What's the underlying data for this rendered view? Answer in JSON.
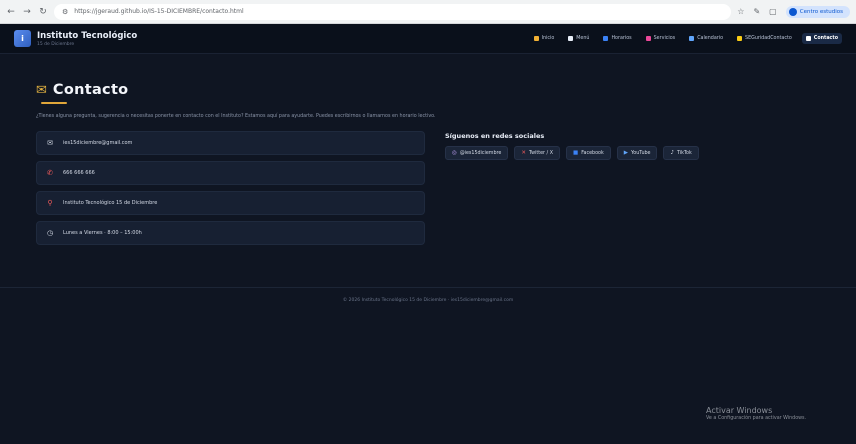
{
  "browser": {
    "url": "https://jgeraud.github.io/IS-15-DICIEMBRE/contacto.html",
    "profile_label": "Centro estudios"
  },
  "header": {
    "logo_letter": "i",
    "brand_title": "Instituto Tecnológico",
    "brand_subtitle": "15 de Diciembre",
    "nav": [
      {
        "label": "Inicio",
        "color": "#f2b134"
      },
      {
        "label": "Menú",
        "color": "#e8eef8"
      },
      {
        "label": "Horarios",
        "color": "#3b82f6"
      },
      {
        "label": "Servicios",
        "color": "#ec4899"
      },
      {
        "label": "Calendario",
        "color": "#60a5fa"
      },
      {
        "label": "SEGuridadContacto",
        "color": "#facc15"
      },
      {
        "label": "Contacto",
        "color": "#ffffff"
      }
    ]
  },
  "page": {
    "title": "Contacto",
    "intro": "¿Tienes alguna pregunta, sugerencia o necesitas ponerte en contacto con el Instituto? Estamos aquí para ayudarte. Puedes escribirnos o llamarnos en horario lectivo."
  },
  "contacts": [
    {
      "icon": "mail-icon",
      "glyph": "✉",
      "color": "#d5dbe7",
      "text": "ies15diciembre@gmail.com"
    },
    {
      "icon": "phone-icon",
      "glyph": "✆",
      "color": "#f05a5a",
      "text": "666 666 666"
    },
    {
      "icon": "location-pin-icon",
      "glyph": "⚲",
      "color": "#f05a5a",
      "text": "Instituto Tecnológico 15 de Diciembre"
    },
    {
      "icon": "clock-icon",
      "glyph": "◷",
      "color": "#d5dbe7",
      "text": "Lunes a Viernes · 8:00 – 15:00h"
    }
  ],
  "social": {
    "heading": "Síguenos en redes sociales",
    "buttons": [
      {
        "icon": "instagram-icon",
        "glyph": "◎",
        "color": "#c9a7ff",
        "label": "@ies15diciembre"
      },
      {
        "icon": "twitter-icon",
        "glyph": "✕",
        "color": "#f05a5a",
        "label": "Twitter / X"
      },
      {
        "icon": "facebook-icon",
        "glyph": "■",
        "color": "#3b82f6",
        "label": "Facebook"
      },
      {
        "icon": "youtube-icon",
        "glyph": "▶",
        "color": "#60a5fa",
        "label": "YouTube"
      },
      {
        "icon": "tiktok-icon",
        "glyph": "♪",
        "color": "#d5dbe7",
        "label": "TikTok"
      }
    ]
  },
  "footer": {
    "text": "© 2026 Instituto Tecnológico 15 de Diciembre · ies15diciembre@gmail.com"
  },
  "watermark": {
    "line1": "Activar Windows",
    "line2": "Ve a Configuración para activar Windows."
  }
}
